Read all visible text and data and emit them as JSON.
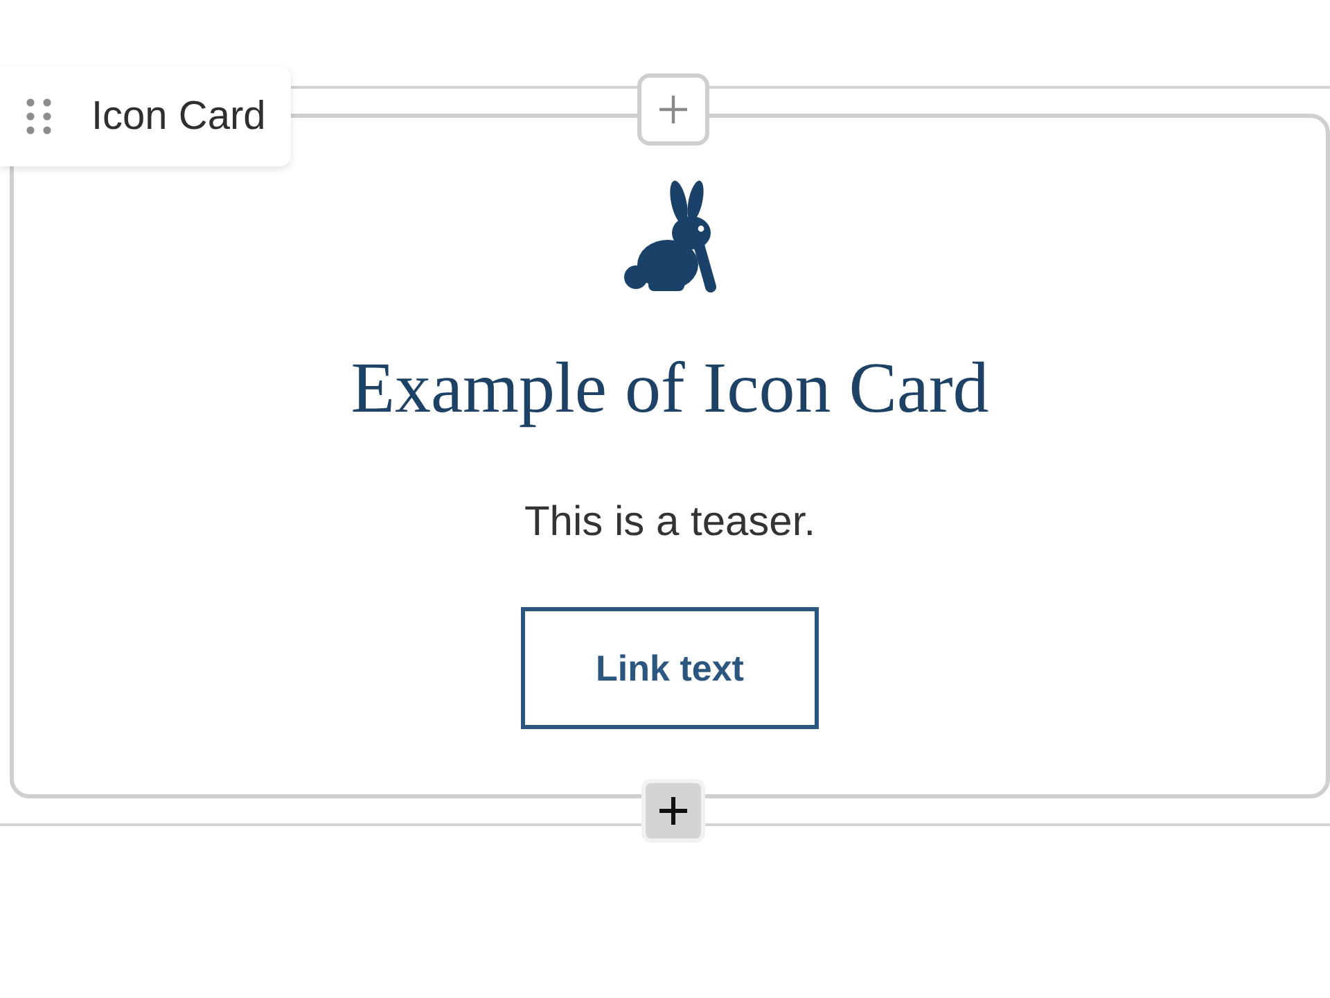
{
  "block": {
    "label": "Icon Card"
  },
  "card": {
    "heading": "Example of Icon Card",
    "teaser": "This is a teaser.",
    "link_button": "Link text"
  },
  "add_buttons": [
    {
      "kind": "top",
      "highlighted": false
    },
    {
      "kind": "bottom",
      "highlighted": true
    }
  ]
}
